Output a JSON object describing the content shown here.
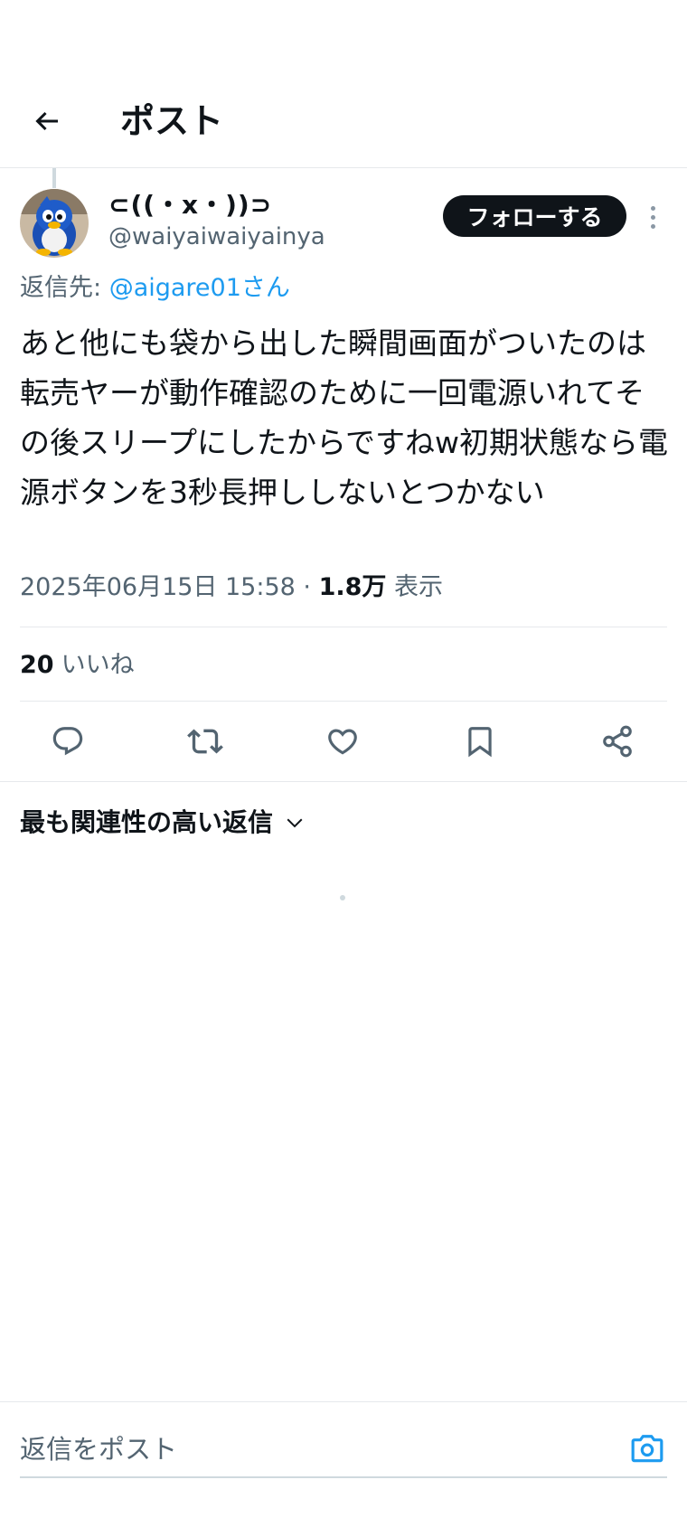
{
  "header": {
    "title": "ポスト"
  },
  "post": {
    "author": {
      "display_name": "⊂((・x・))⊃",
      "handle": "@waiyaiwaiyainya"
    },
    "follow_label": "フォローする",
    "reply_to": {
      "prefix": "返信先: ",
      "mention": "@aigare01さん"
    },
    "text": "あと他にも袋から出した瞬間画面がついたのは転売ヤーが動作確認のために一回電源いれてその後スリープにしたからですねw初期状態なら電源ボタンを3秒長押ししないとつかない",
    "timestamp": "2025年06月15日 15:58",
    "separator": " · ",
    "views_count": "1.8万",
    "views_label": " 表示",
    "likes_count": "20",
    "likes_label": "いいね"
  },
  "replies": {
    "sort_label": "最も関連性の高い返信"
  },
  "composer": {
    "placeholder": "返信をポスト"
  },
  "colors": {
    "accent": "#1d9bf0",
    "text_primary": "#0f1419",
    "text_secondary": "#536471",
    "divider": "#e6e9ec"
  },
  "icons": {
    "back": "arrow-left-icon",
    "more": "more-vertical-icon",
    "reply": "reply-icon",
    "repost": "repost-icon",
    "like": "heart-icon",
    "bookmark": "bookmark-icon",
    "share": "share-icon",
    "sort": "chevron-down-icon",
    "camera": "camera-icon"
  }
}
